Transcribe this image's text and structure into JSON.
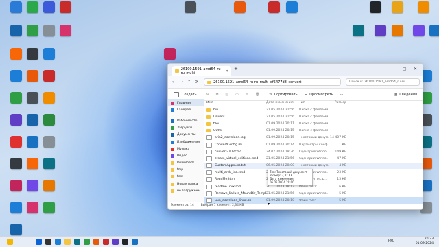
{
  "desktop_icons": [
    {
      "label": "",
      "color": "#2a7ad8"
    },
    {
      "label": "",
      "color": "#2aa84a"
    },
    {
      "label": "",
      "color": "#3b5bdb"
    },
    {
      "label": "",
      "color": "#c92a2a"
    },
    {
      "label": "",
      "color": "#495057"
    },
    {
      "label": "",
      "color": "#e8590c"
    },
    {
      "label": "",
      "color": "#c92a2a"
    },
    {
      "label": "",
      "color": "#1c7ed6"
    },
    {
      "label": "",
      "color": "#212529"
    },
    {
      "label": "",
      "color": "#e8a317"
    },
    {
      "label": "",
      "color": "#f08c00"
    },
    {
      "label": "",
      "color": "#1864ab"
    },
    {
      "label": "",
      "color": "#2f9e44"
    },
    {
      "label": "",
      "color": "#868e96"
    },
    {
      "label": "",
      "color": "#d6336c"
    },
    {
      "label": "",
      "color": "#0b7285"
    },
    {
      "label": "",
      "color": "#5f3dc4"
    },
    {
      "label": "",
      "color": "#e67700"
    },
    {
      "label": "",
      "color": "#7048e8"
    },
    {
      "label": "",
      "color": "#1971c2"
    },
    {
      "label": "",
      "color": "#f76707"
    },
    {
      "label": "",
      "color": "#343a40"
    },
    {
      "label": "",
      "color": "#1c7ed6"
    },
    {
      "label": "",
      "color": "#c2255c"
    }
  ],
  "window": {
    "tab_title": "26100.1591_amd64_ru-ru_multi",
    "path": "26100.1591_amd64_ru-ru_multi_df5477d8_convert",
    "search_placeholder": "Поиск в: 26100.1591_amd64_ru-ru...",
    "commands": {
      "create": "Создать",
      "sort": "Сортировать",
      "view": "Просмотреть",
      "details": "Сведения"
    },
    "sidebar": [
      {
        "label": "Главная",
        "color": "#d6336c"
      },
      {
        "label": "Галерея",
        "color": "#1c7ed6"
      },
      {
        "label": "Рабочий сто",
        "color": "#1971c2"
      },
      {
        "label": "Загрузки",
        "color": "#2f9e44"
      },
      {
        "label": "Документы",
        "color": "#1864ab"
      },
      {
        "label": "Изображения",
        "color": "#1c7ed6"
      },
      {
        "label": "Музыка",
        "color": "#e03131"
      },
      {
        "label": "Видео",
        "color": "#7048e8"
      },
      {
        "label": "Downloads",
        "color": "#f4c542"
      },
      {
        "label": "tmp",
        "color": "#f4c542"
      },
      {
        "label": "test",
        "color": "#f4c542"
      },
      {
        "label": "Новая папка",
        "color": "#f4c542"
      },
      {
        "label": "не загружены",
        "color": "#f4c542"
      }
    ],
    "columns": {
      "name": "Имя",
      "date": "Дата изменения",
      "type": "Тип",
      "size": "Размер"
    },
    "files": [
      {
        "name": "bin",
        "date": "21.05.2024 21:56",
        "type": "Папка с файлами",
        "size": "",
        "kind": "folder"
      },
      {
        "name": "Drivers",
        "date": "21.05.2024 21:56",
        "type": "Папка с файлами",
        "size": "",
        "kind": "folder"
      },
      {
        "name": "files",
        "date": "01.09.2024 20:11",
        "type": "Папка с файлами",
        "size": "",
        "kind": "folder"
      },
      {
        "name": "UUPs",
        "date": "01.09.2024 20:15",
        "type": "Папка с файлами",
        "size": "",
        "kind": "folder"
      },
      {
        "name": "aria2_download.log",
        "date": "01.09.2024 20:15",
        "type": "Текстовый докум...",
        "size": "14 407 КБ",
        "kind": "file"
      },
      {
        "name": "ConvertConfig.ini",
        "date": "01.09.2024 20:14",
        "type": "Параметры конф...",
        "size": "1 КБ",
        "kind": "file"
      },
      {
        "name": "convert-UUP.cmd",
        "date": "24.07.2024 19:36",
        "type": "Сценарий Windo...",
        "size": "149 КБ",
        "kind": "file"
      },
      {
        "name": "create_virtual_editions.cmd",
        "date": "21.05.2024 21:56",
        "type": "Сценарий Windo...",
        "size": "47 КБ",
        "kind": "file"
      },
      {
        "name": "CustomAppsList.txt",
        "date": "06.05.2024 20:00",
        "type": "Текстовый докум...",
        "size": "4 КБ",
        "kind": "file"
      },
      {
        "name": "multi_arch_iso.cmd",
        "date": "21.05.2024 21:56",
        "type": "Сценарий Windo...",
        "size": "23 КБ",
        "kind": "file"
      },
      {
        "name": "ReadMe.html",
        "date": "21.05.2024 21:56",
        "type": "Chrome HTML D...",
        "size": "15 КБ",
        "kind": "file"
      },
      {
        "name": "readme.unix.md",
        "date": "20.11.2023 18:17",
        "type": "Файл \"MD\"",
        "size": "6 КБ",
        "kind": "file"
      },
      {
        "name": "Remove_Failure_MountDir_TempDir.cmd",
        "date": "21.05.2024 21:56",
        "type": "Сценарий Windo...",
        "size": "5 КБ",
        "kind": "file"
      },
      {
        "name": "uup_download_linux.sh",
        "date": "01.09.2024 20:10",
        "type": "Файл \"SH\"",
        "size": "5 КБ",
        "kind": "file"
      }
    ],
    "tooltip": [
      "Тип: Текстовый документ",
      "Размер: 3,32 КБ",
      "Дата изменения: 06.05.2024 20:00"
    ],
    "status": {
      "count": "Элементов: 14",
      "selected": "Выбран 1 элемент: 2,34 КБ"
    }
  },
  "taskbar": {
    "lang": "РУС",
    "time": "20:23",
    "date": "01.09.2024"
  }
}
